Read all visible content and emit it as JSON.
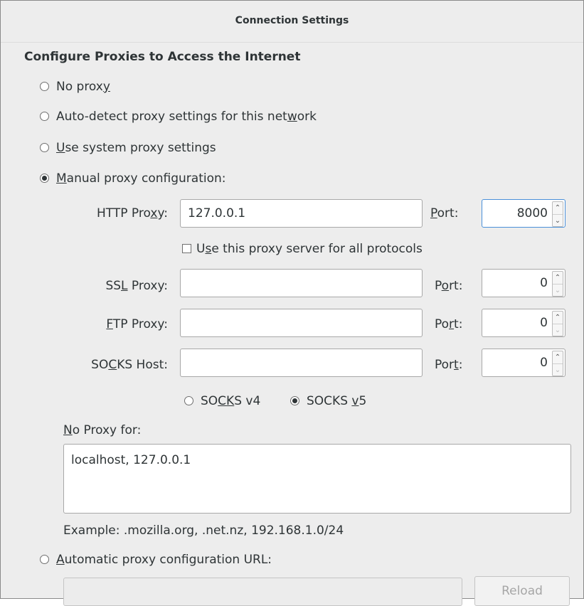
{
  "window": {
    "title": "Connection Settings"
  },
  "section": {
    "heading": "Configure Proxies to Access the Internet"
  },
  "radios": {
    "no_proxy": {
      "pre": "No prox",
      "mn": "y",
      "post": "",
      "checked": false
    },
    "auto_detect": {
      "pre": "Auto-detect proxy settings for this net",
      "mn": "w",
      "post": "ork",
      "checked": false
    },
    "system": {
      "pre": "",
      "mn": "U",
      "post": "se system proxy settings",
      "checked": false
    },
    "manual": {
      "pre": "",
      "mn": "M",
      "post": "anual proxy configuration:",
      "checked": true
    },
    "auto_url": {
      "pre": "",
      "mn": "A",
      "post": "utomatic proxy configuration URL:",
      "checked": false
    }
  },
  "http": {
    "label_pre": "HTTP Pro",
    "label_mn": "x",
    "label_post": "y:",
    "value": "127.0.0.1",
    "port_pre": "",
    "port_mn": "P",
    "port_post": "ort:",
    "port": "8000"
  },
  "share": {
    "pre": "U",
    "mn": "s",
    "post": "e this proxy server for all protocols",
    "checked": false
  },
  "ssl": {
    "label_pre": "SS",
    "label_mn": "L",
    "label_post": " Proxy:",
    "value": "",
    "port_pre": "P",
    "port_mn": "o",
    "port_post": "rt:",
    "port": "0"
  },
  "ftp": {
    "label_pre": "",
    "label_mn": "F",
    "label_post": "TP Proxy:",
    "value": "",
    "port_pre": "Po",
    "port_mn": "r",
    "port_post": "t:",
    "port": "0"
  },
  "socks": {
    "label_pre": "SO",
    "label_mn": "C",
    "label_post": "KS Host:",
    "value": "",
    "port_pre": "Por",
    "port_mn": "t",
    "port_post": ":",
    "port": "0"
  },
  "socks_version": {
    "v4": {
      "pre": "SO",
      "mn": "C",
      "mn2": "K",
      "post": "S v4",
      "checked": false
    },
    "v5": {
      "pre": "SOCKS ",
      "mn": "v",
      "post": "5",
      "checked": true
    }
  },
  "no_proxy_for": {
    "label_mn": "N",
    "label_post": "o Proxy for:",
    "value": "localhost, 127.0.0.1"
  },
  "example": "Example: .mozilla.org, .net.nz, 192.168.1.0/24",
  "auto_url_field": {
    "value": ""
  },
  "reload_button": "Reload"
}
